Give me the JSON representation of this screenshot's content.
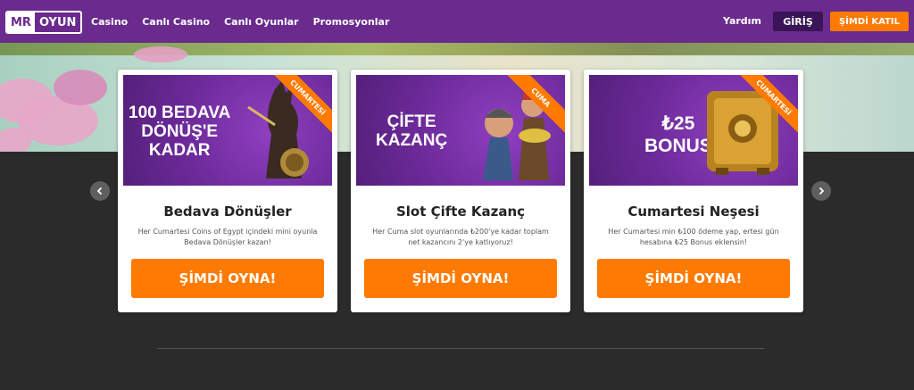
{
  "header": {
    "logo_left": "MR",
    "logo_right": "OYUN",
    "nav": [
      "Casino",
      "Canlı Casino",
      "Canlı Oyunlar",
      "Promosyonlar"
    ],
    "help": "Yardım",
    "login": "GİRİŞ",
    "join": "ŞİMDİ KATIL"
  },
  "cards": [
    {
      "banner_text": "100 BEDAVA\nDÖNÜŞ'E\nKADAR",
      "ribbon": "CUMARTESİ",
      "title": "Bedava Dönüşler",
      "description": "Her Cumartesi Coins of Egypt içindeki mini oyunla Bedava Dönüşler kazan!",
      "button": "ŞİMDİ OYNA!"
    },
    {
      "banner_text": "ÇİFTE\nKAZANÇ",
      "ribbon": "CUMA",
      "title": "Slot Çifte Kazanç",
      "description": "Her Cuma slot oyunlarında ₺200'ye kadar toplam net kazancını 2'ye katlıyoruz!",
      "button": "ŞİMDİ OYNA!"
    },
    {
      "banner_text": "₺25\nBONUS",
      "ribbon": "CUMARTESİ",
      "title": "Cumartesi Neşesi",
      "description": "Her Cumartesi min ₺100 ödeme yap, ertesi gün hesabına ₺25 Bonus eklensin!",
      "button": "ŞİMDİ OYNA!"
    }
  ],
  "icons": {
    "prev": "chevron-left-icon",
    "next": "chevron-right-icon"
  },
  "colors": {
    "header": "#6a2a8e",
    "accent": "#ff7a00",
    "background": "#2b2b2b"
  }
}
